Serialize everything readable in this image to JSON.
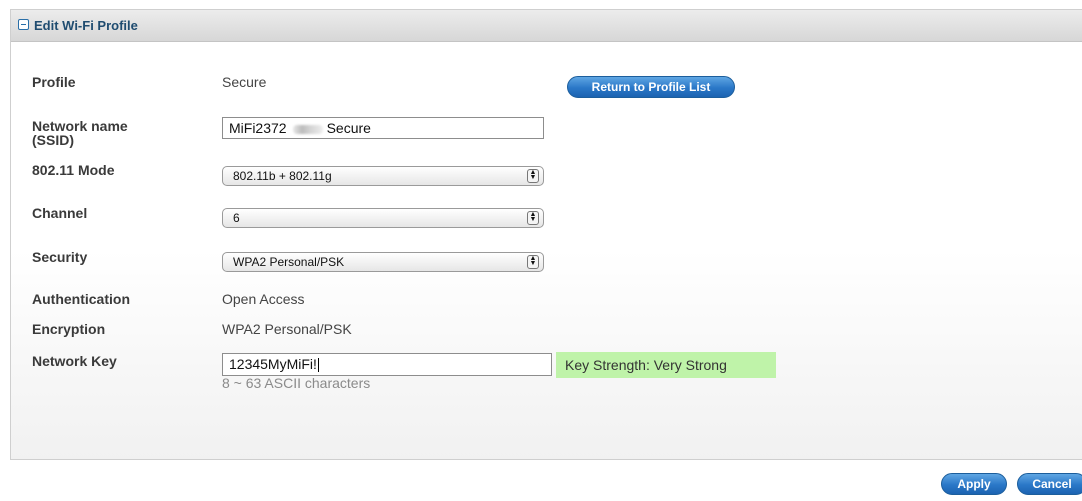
{
  "panel": {
    "title": "Edit Wi-Fi Profile"
  },
  "form": {
    "profile": {
      "label": "Profile",
      "value": "Secure"
    },
    "return_button": "Return to Profile List",
    "ssid": {
      "label_line1": "Network name",
      "label_line2": "(SSID)",
      "value_prefix": "MiFi2372",
      "value_suffix": "Secure"
    },
    "mode": {
      "label": "802.11 Mode",
      "value": "802.11b + 802.11g"
    },
    "channel": {
      "label": "Channel",
      "value": "6"
    },
    "security": {
      "label": "Security",
      "value": "WPA2 Personal/PSK"
    },
    "authentication": {
      "label": "Authentication",
      "value": "Open Access"
    },
    "encryption": {
      "label": "Encryption",
      "value": "WPA2 Personal/PSK"
    },
    "network_key": {
      "label": "Network Key",
      "value": "12345MyMiFi!",
      "hint": "8 ~ 63 ASCII characters"
    },
    "key_strength": "Key Strength: Very Strong"
  },
  "footer": {
    "apply": "Apply",
    "cancel": "Cancel"
  },
  "colors": {
    "accent_blue": "#2a77c7",
    "strength_green": "#bff3a9",
    "title_blue": "#1f4c70"
  }
}
